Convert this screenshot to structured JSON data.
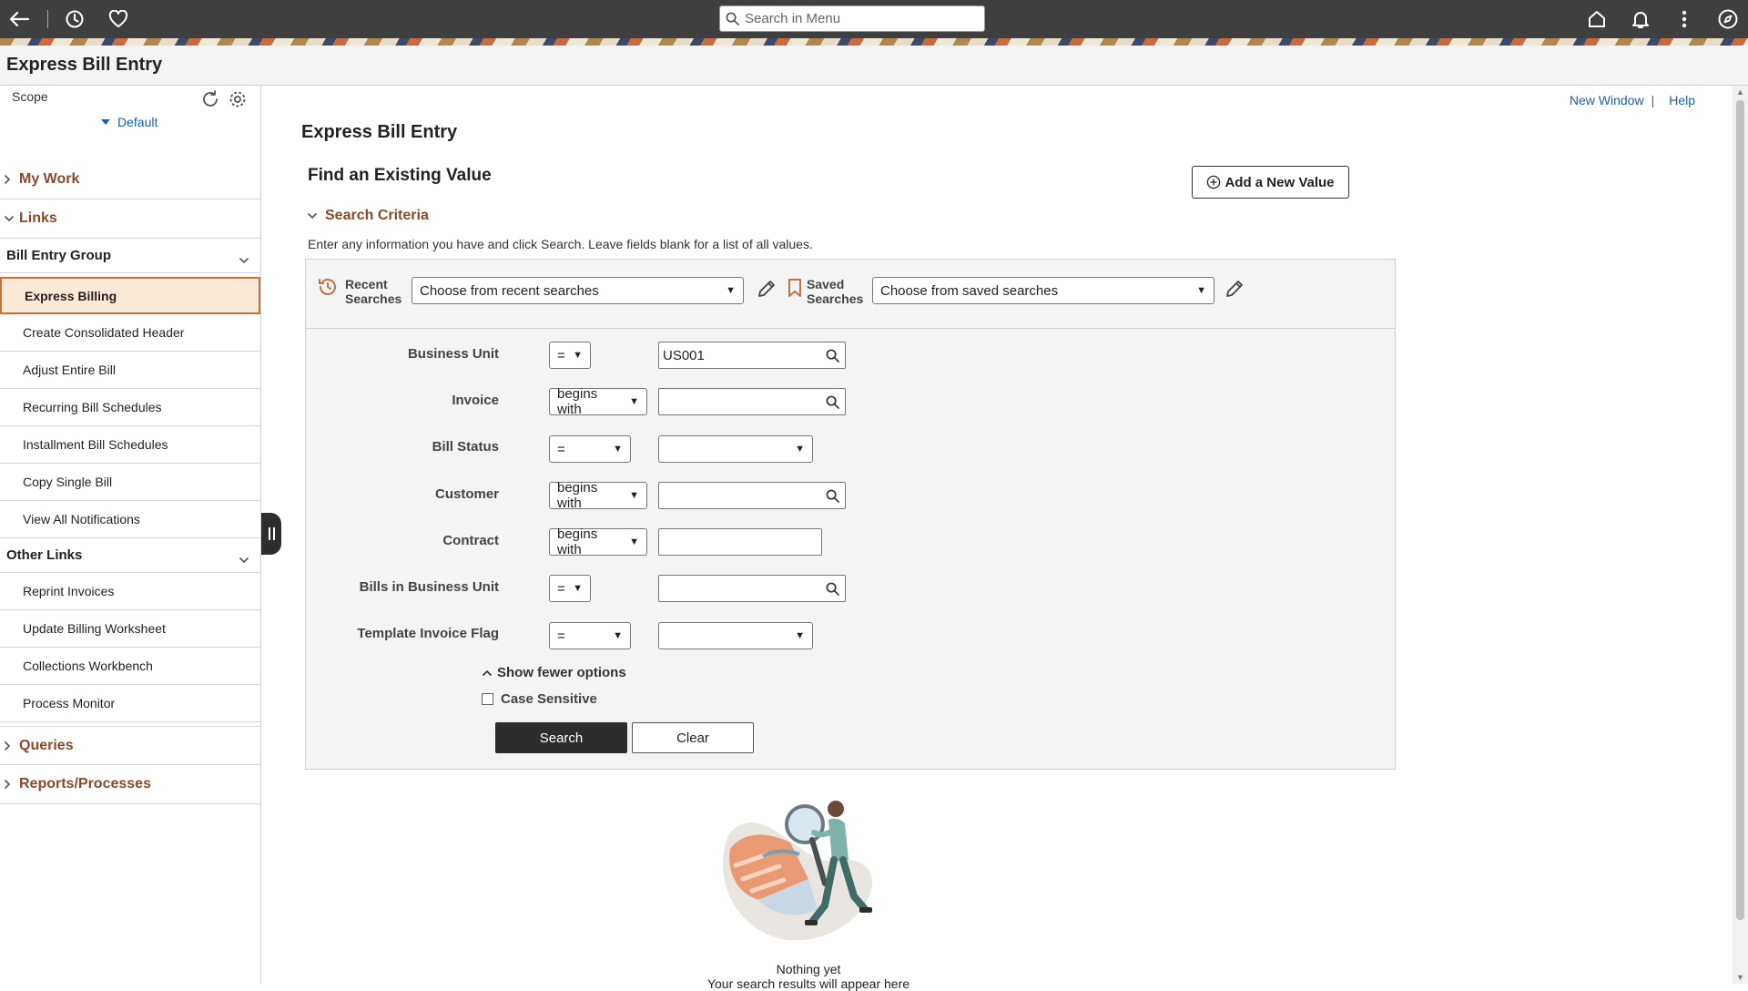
{
  "topbar": {
    "search_placeholder": "Search in Menu"
  },
  "page": {
    "title": "Express Bill Entry"
  },
  "left_panel": {
    "scope_label": "Scope",
    "scope_value": "Default",
    "sections": {
      "my_work": "My Work",
      "links": "Links",
      "queries": "Queries",
      "reports": "Reports/Processes"
    },
    "bill_entry_group": {
      "label": "Bill Entry Group",
      "items": [
        "Express Billing",
        "Create Consolidated Header",
        "Adjust Entire Bill",
        "Recurring Bill Schedules",
        "Installment Bill Schedules",
        "Copy Single Bill",
        "View All Notifications"
      ],
      "active_index": 0
    },
    "other_links": {
      "label": "Other Links",
      "items": [
        "Reprint Invoices",
        "Update Billing Worksheet",
        "Collections Workbench",
        "Process Monitor"
      ]
    }
  },
  "content": {
    "new_window": "New Window",
    "help": "Help",
    "heading": "Express Bill Entry",
    "subheading": "Find an Existing Value",
    "add_new": "Add a New Value",
    "criteria_label": "Search Criteria",
    "instructions": "Enter any information you have and click Search. Leave fields blank for a list of all values.",
    "recent_searches_label_1": "Recent",
    "recent_searches_label_2": "Searches",
    "recent_searches_value": "Choose from recent searches",
    "saved_searches_label_1": "Saved",
    "saved_searches_label_2": "Searches",
    "saved_searches_value": "Choose from saved searches",
    "fields": [
      {
        "label": "Business Unit",
        "operator": "=",
        "value": "US001",
        "type": "lookup"
      },
      {
        "label": "Invoice",
        "operator": "begins with",
        "value": "",
        "type": "lookup"
      },
      {
        "label": "Bill Status",
        "operator": "=",
        "value": "",
        "type": "select"
      },
      {
        "label": "Customer",
        "operator": "begins with",
        "value": "",
        "type": "lookup"
      },
      {
        "label": "Contract",
        "operator": "begins with",
        "value": "",
        "type": "text"
      },
      {
        "label": "Bills in Business Unit",
        "operator": "=",
        "value": "",
        "type": "lookup"
      },
      {
        "label": "Template Invoice Flag",
        "operator": "=",
        "value": "",
        "type": "select"
      }
    ],
    "show_fewer": "Show fewer options",
    "case_sensitive": "Case Sensitive",
    "search_btn": "Search",
    "clear_btn": "Clear",
    "empty_title": "Nothing yet",
    "empty_sub": "Your search results will appear here"
  },
  "colors": {
    "topbar": "#3f3f3f",
    "accent_brown": "#8a4a2a",
    "link_blue": "#1a5fa8",
    "active_bg": "#fbe9d7",
    "active_border": "#c5703e"
  }
}
